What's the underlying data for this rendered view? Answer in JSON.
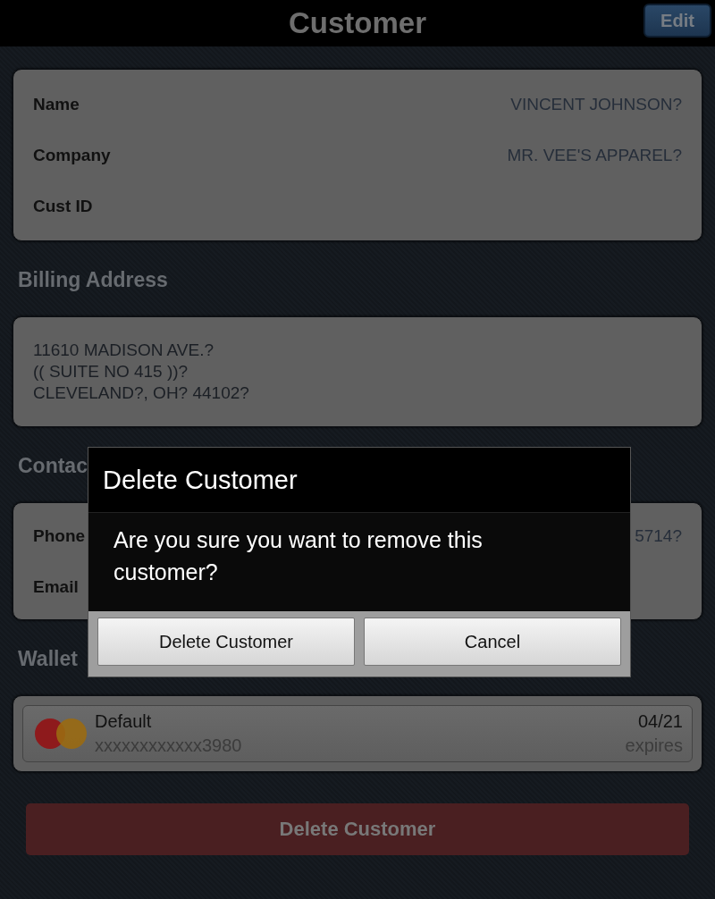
{
  "header": {
    "title": "Customer",
    "edit_button": "Edit"
  },
  "customer": {
    "rows": [
      {
        "label": "Name",
        "value": "VINCENT JOHNSON?"
      },
      {
        "label": "Company",
        "value": "MR. VEE'S APPAREL?"
      },
      {
        "label": "Cust ID"
      }
    ]
  },
  "billing_address": {
    "heading": "Billing Address",
    "lines": [
      "11610 MADISON AVE.?",
      "(( SUITE NO 415 ))?",
      "CLEVELAND?, OH? 44102?"
    ]
  },
  "contact_info": {
    "heading": "Contac",
    "rows": [
      {
        "label": "Phone",
        "value": "5714?"
      },
      {
        "label": "Email"
      }
    ]
  },
  "wallet": {
    "heading": "Wallet",
    "cards": [
      {
        "name": "Default",
        "number": "xxxxxxxxxxxx3980",
        "expiry": "04/21",
        "expiry_label": "expires"
      }
    ]
  },
  "delete_button": "Delete Customer",
  "dialog": {
    "title": "Delete Customer",
    "message": "Are you sure you want to remove this customer?",
    "buttons": [
      "Delete Customer",
      "Cancel"
    ]
  }
}
